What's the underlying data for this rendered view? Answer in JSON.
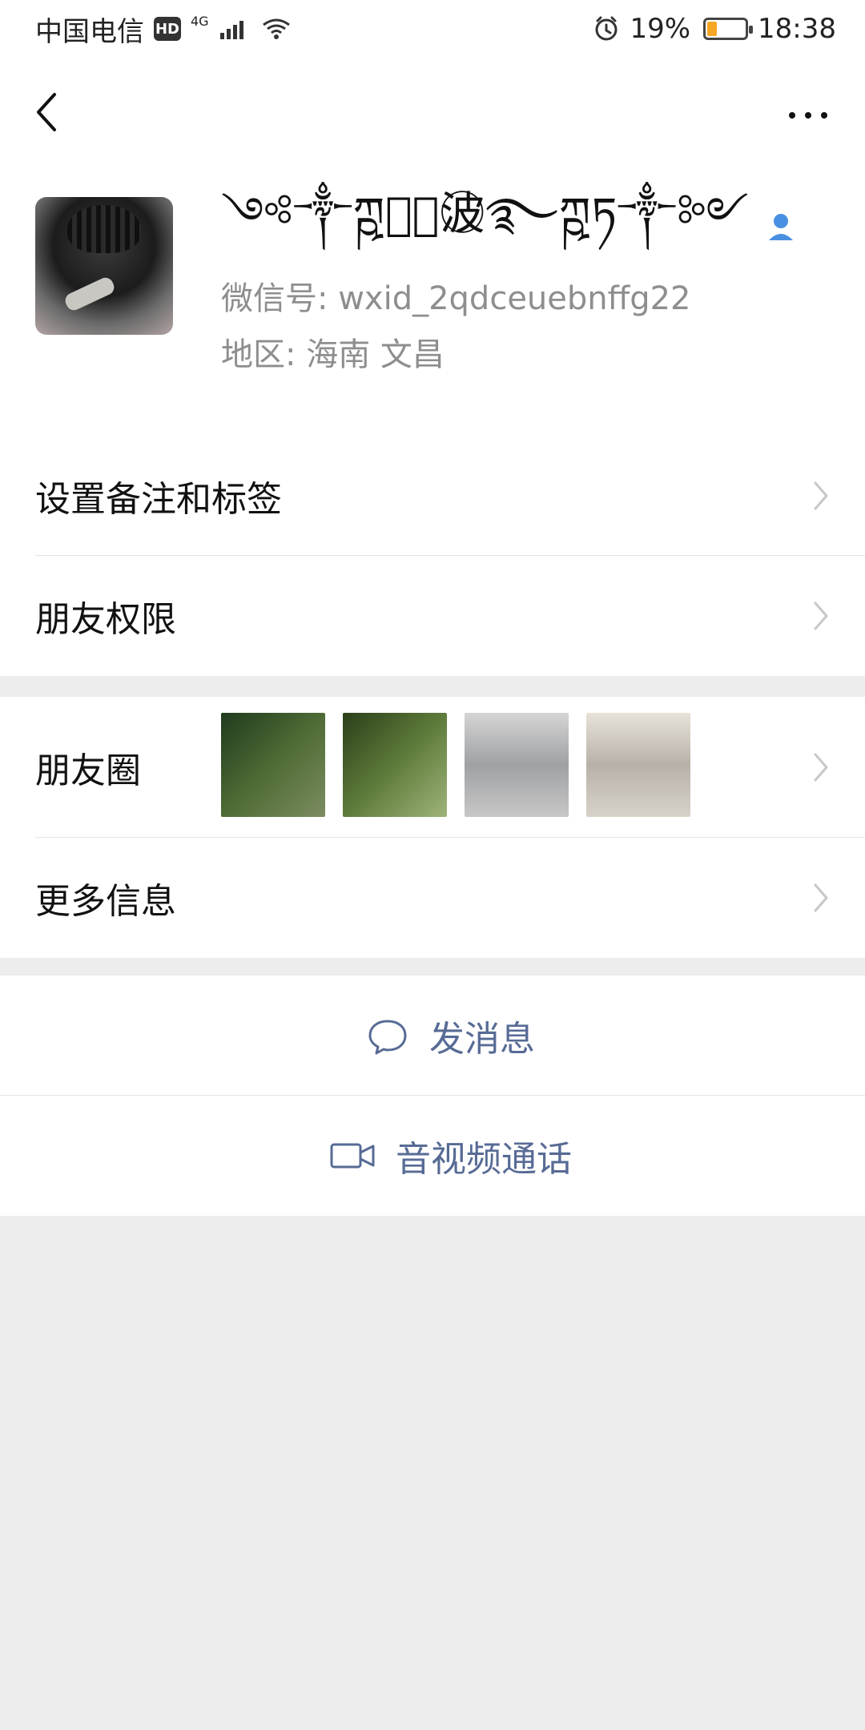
{
  "status_bar": {
    "carrier": "中国电信",
    "hd_badge": "HD",
    "network": "4G",
    "battery_percent": "19%",
    "time": "18:38"
  },
  "profile": {
    "display_name": "༺༒ཀྵ࿐⃝波⃝࿐ཀྵཏ༒༻",
    "wechat_id_label": "微信号:",
    "wechat_id_value": "wxid_2qdceuebnffg22",
    "region_label": "地区:",
    "region_value": "海南  文昌"
  },
  "menu": {
    "set_remark_tags": "设置备注和标签",
    "friend_permissions": "朋友权限",
    "moments": "朋友圈",
    "more_info": "更多信息"
  },
  "actions": {
    "send_message": "发消息",
    "video_call": "音视频通话"
  },
  "colors": {
    "link": "#576b95",
    "bg": "#ededed",
    "battery_low": "#f6a623"
  }
}
